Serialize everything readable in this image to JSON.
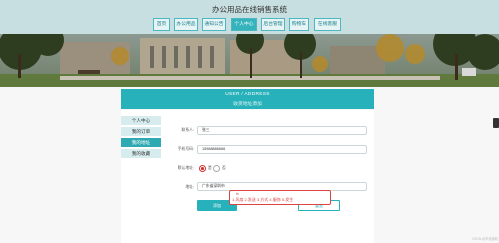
{
  "site": {
    "title": "办公用品在线销售系统"
  },
  "nav": {
    "items": [
      {
        "label": "首页"
      },
      {
        "label": "办公用品"
      },
      {
        "label": "通知公告"
      },
      {
        "label": "个人中心"
      },
      {
        "label": "后台管理"
      },
      {
        "label": "购物车"
      },
      {
        "label": "在线客服"
      }
    ],
    "active_index": 3
  },
  "page_header": {
    "english": "USER / ADDRESS",
    "chinese": "收货地址添加"
  },
  "sidebar": {
    "items": [
      {
        "label": "个人中心"
      },
      {
        "label": "我的订单"
      },
      {
        "label": "我的地址"
      },
      {
        "label": "我的收藏"
      }
    ],
    "active_index": 2
  },
  "form": {
    "name_label": "联系人:",
    "name_value": "张三",
    "phone_label": "手机号码:",
    "phone_value": "15988886666",
    "default_label": "默认地址:",
    "option_yes": "是",
    "option_no": "否",
    "default_selected": "是",
    "address_label": "地址:",
    "address_value": "广东省深圳市",
    "submit_label": "添加",
    "reset_label": "重置"
  },
  "ime": {
    "input": "fs",
    "candidates": [
      "1.风扇",
      "2.发送",
      "3.方式",
      "4.服饰",
      "5.发生"
    ]
  },
  "watermark": "CSDN @毕设源码",
  "colors": {
    "primary": "#27b1ba",
    "header_bg": "#c8dfe1",
    "ime": "#d44"
  }
}
